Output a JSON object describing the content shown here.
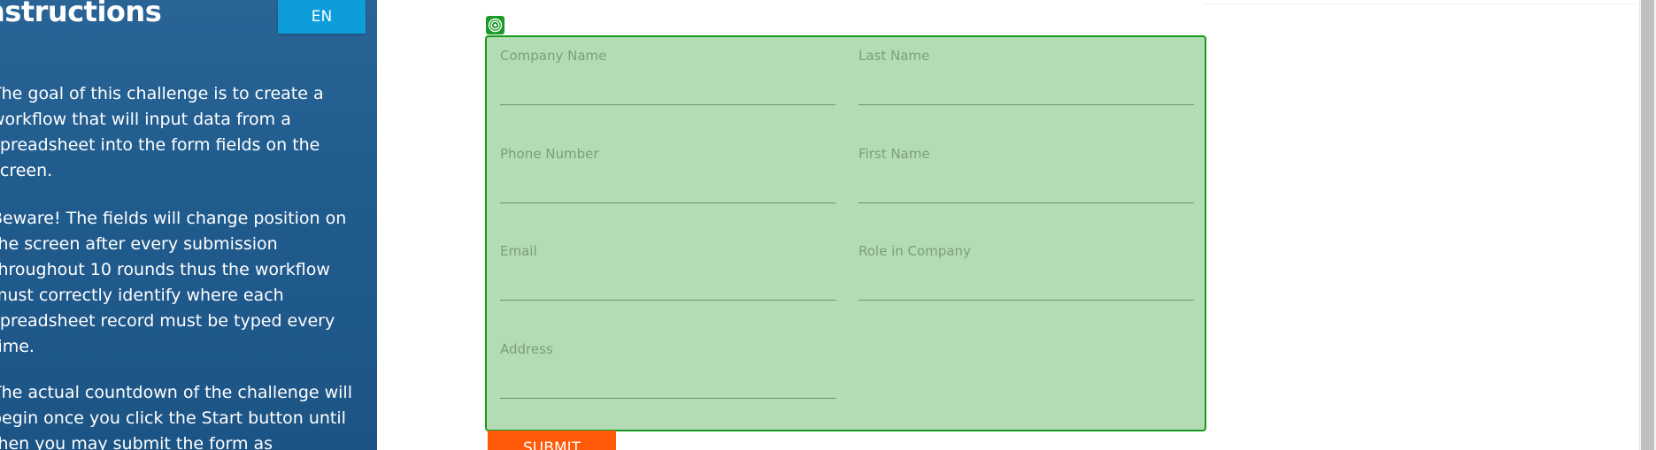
{
  "sidebar": {
    "title": "nstructions",
    "lang_button": "EN",
    "paragraphs": [
      "The goal of this challenge is to create a workflow that will input data from a spreadsheet into the form fields on the screen.",
      "Beware! The fields will change position on the screen after every submission throughout 10 rounds thus the workflow must correctly identify where each spreadsheet record must be typed every time.",
      "The actual countdown of the challenge will begin once you click the Start button until then you may submit the form as"
    ]
  },
  "form": {
    "fields": [
      {
        "label": "Company Name",
        "value": ""
      },
      {
        "label": "Last Name",
        "value": ""
      },
      {
        "label": "Phone Number",
        "value": ""
      },
      {
        "label": "First Name",
        "value": ""
      },
      {
        "label": "Email",
        "value": ""
      },
      {
        "label": "Role in Company",
        "value": ""
      },
      {
        "label": "Address",
        "value": ""
      }
    ],
    "submit_label": "SUBMIT"
  },
  "icons": {
    "form_badge": "target-icon"
  },
  "colors": {
    "sidebar_bg": "#215c8e",
    "lang_button_bg": "#0d9ddb",
    "form_bg": "#b4dcb4",
    "form_border": "#169a1e",
    "submit_bg": "#ff5a0a"
  }
}
